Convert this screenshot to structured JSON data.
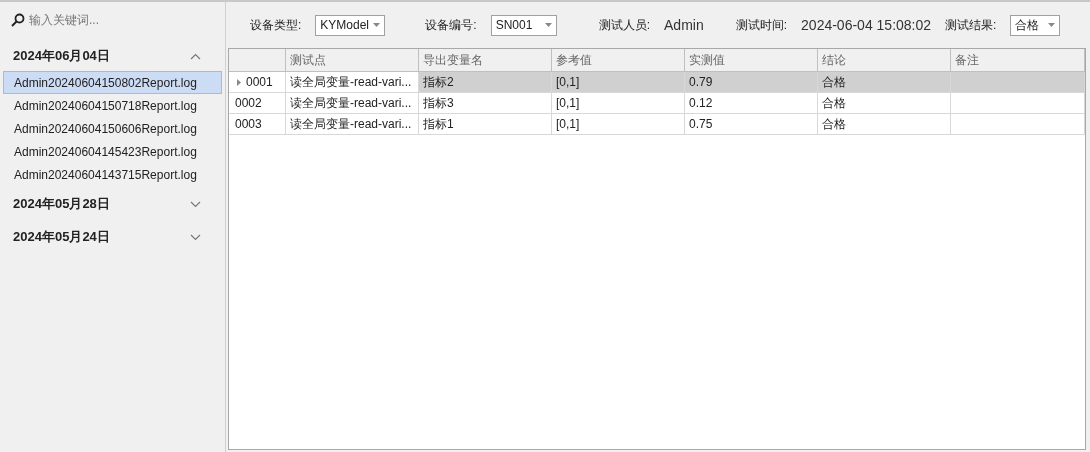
{
  "search": {
    "placeholder": "输入关键词..."
  },
  "groups": [
    {
      "title": "2024年06月04日",
      "expanded": true,
      "files": [
        {
          "name": "Admin20240604150802Report.log",
          "selected": true
        },
        {
          "name": "Admin20240604150718Report.log",
          "selected": false
        },
        {
          "name": "Admin20240604150606Report.log",
          "selected": false
        },
        {
          "name": "Admin20240604145423Report.log",
          "selected": false
        },
        {
          "name": "Admin20240604143715Report.log",
          "selected": false
        }
      ]
    },
    {
      "title": "2024年05月28日",
      "expanded": false
    },
    {
      "title": "2024年05月24日",
      "expanded": false
    }
  ],
  "toolbar": {
    "device_type_label": "设备类型:",
    "device_type": "KYModel",
    "device_sn_label": "设备编号:",
    "device_sn": "SN001",
    "tester_label": "测试人员:",
    "tester": "Admin",
    "test_time_label": "测试时间:",
    "test_time": "2024-06-04 15:08:02",
    "result_label": "测试结果:",
    "result": "合格"
  },
  "table": {
    "columns": [
      "测试点",
      "导出变量名",
      "参考值",
      "实测值",
      "结论",
      "备注"
    ],
    "rows": [
      {
        "id": "0001",
        "selected": true,
        "cells": [
          "读全局变量-read-vari...",
          "指标2",
          "[0,1]",
          "0.79",
          "合格",
          ""
        ]
      },
      {
        "id": "0002",
        "selected": false,
        "cells": [
          "读全局变量-read-vari...",
          "指标3",
          "[0,1]",
          "0.12",
          "合格",
          ""
        ]
      },
      {
        "id": "0003",
        "selected": false,
        "cells": [
          "读全局变量-read-vari...",
          "指标1",
          "[0,1]",
          "0.75",
          "合格",
          ""
        ]
      }
    ]
  }
}
